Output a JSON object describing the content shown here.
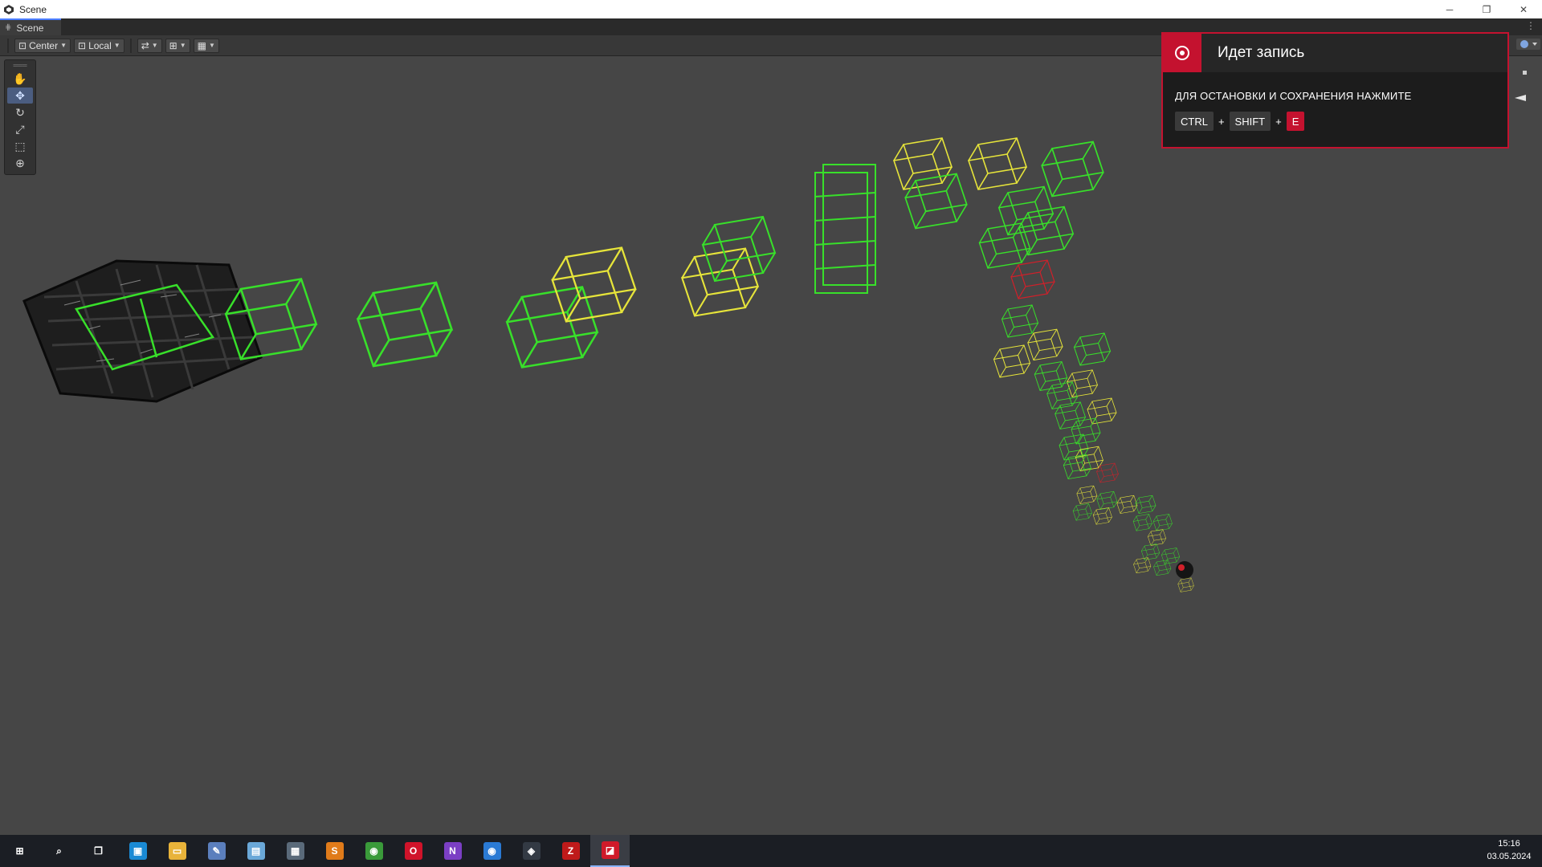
{
  "window": {
    "title": "Scene",
    "controls": {
      "minimize": "─",
      "restore": "❐",
      "close": "✕"
    }
  },
  "tab": {
    "label": "Scene",
    "grid_glyph": "⋕",
    "menu": "⋮"
  },
  "toolbar": {
    "pivot_label": "Center",
    "space_label": "Local",
    "caret": "▼",
    "snap_glyph": "⇄",
    "grid_glyph": "⊞",
    "view_glyph": "▦"
  },
  "tools": {
    "handle": "═══",
    "items": [
      {
        "name": "hand-tool",
        "glyph": "✋"
      },
      {
        "name": "move-tool",
        "glyph": "✥"
      },
      {
        "name": "rotate-tool",
        "glyph": "↻"
      },
      {
        "name": "scale-tool",
        "glyph": "⤢"
      },
      {
        "name": "rect-tool",
        "glyph": "⬚"
      },
      {
        "name": "transform-tool",
        "glyph": "⊕"
      }
    ]
  },
  "recording": {
    "title": "Идет запись",
    "hint": "ДЛЯ ОСТАНОВКИ И СОХРАНЕНИЯ НАЖМИТЕ",
    "keys": [
      "CTRL",
      "SHIFT",
      "E"
    ],
    "plus": "+"
  },
  "colors": {
    "green": "#38e02a",
    "yellow": "#e6e43a",
    "red": "#d0202a",
    "accent": "#c4122f"
  },
  "taskbar": {
    "icons": [
      {
        "name": "windows-start-icon",
        "glyph": "⊞",
        "color": "#1b1e24"
      },
      {
        "name": "search-icon",
        "glyph": "⌕",
        "color": "#1b1e24"
      },
      {
        "name": "task-view-icon",
        "glyph": "❐",
        "color": "#1b1e24"
      },
      {
        "name": "store-icon",
        "glyph": "▣",
        "color": "#1a8ad4"
      },
      {
        "name": "file-explorer-icon",
        "glyph": "▭",
        "color": "#e8b33a"
      },
      {
        "name": "paint-icon",
        "glyph": "✎",
        "color": "#5b7fbd"
      },
      {
        "name": "notepad-icon",
        "glyph": "▤",
        "color": "#6aa8d8"
      },
      {
        "name": "calculator-icon",
        "glyph": "▦",
        "color": "#5a6a7a"
      },
      {
        "name": "sublime-text-icon",
        "glyph": "S",
        "color": "#e07b1a"
      },
      {
        "name": "chrome-icon",
        "glyph": "◉",
        "color": "#3a9a3a"
      },
      {
        "name": "opera-icon",
        "glyph": "O",
        "color": "#d0132a"
      },
      {
        "name": "visual-studio-icon",
        "glyph": "N",
        "color": "#7b3fc4"
      },
      {
        "name": "chrome-profile-icon",
        "glyph": "◉",
        "color": "#2a7ad4"
      },
      {
        "name": "unity-icon",
        "glyph": "◈",
        "color": "#333a44"
      },
      {
        "name": "filezilla-icon",
        "glyph": "Z",
        "color": "#bf1a1a"
      },
      {
        "name": "amd-recorder-icon",
        "glyph": "◪",
        "color": "#d01a2a"
      }
    ],
    "active_index": 15
  },
  "clock": {
    "time": "15:16",
    "date": "03.05.2024"
  }
}
